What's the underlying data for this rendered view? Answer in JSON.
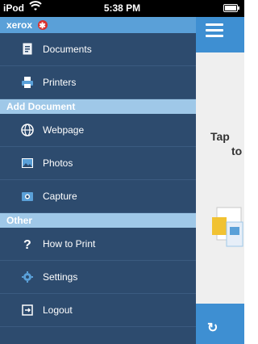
{
  "status_bar": {
    "carrier": "iPod",
    "time": "5:38 PM"
  },
  "brand": {
    "name": "xerox"
  },
  "menu": {
    "items_top": [
      {
        "label": "Documents",
        "icon": "documents-icon"
      },
      {
        "label": "Printers",
        "icon": "printer-icon"
      }
    ],
    "section_add": "Add Document",
    "items_add": [
      {
        "label": "Webpage",
        "icon": "globe-icon"
      },
      {
        "label": "Photos",
        "icon": "photos-icon"
      },
      {
        "label": "Capture",
        "icon": "camera-icon"
      }
    ],
    "section_other": "Other",
    "items_other": [
      {
        "label": "How to Print",
        "icon": "question-icon"
      },
      {
        "label": "Settings",
        "icon": "gear-icon"
      },
      {
        "label": "Logout",
        "icon": "logout-icon"
      }
    ]
  },
  "content": {
    "tap_line1": "Tap",
    "tap_line2": "to"
  },
  "colors": {
    "menu_bg": "#2d4b6e",
    "brand_bar": "#5aa0d8",
    "section_bar": "#9fc8e8",
    "accent_blue": "#3e8fd2"
  }
}
